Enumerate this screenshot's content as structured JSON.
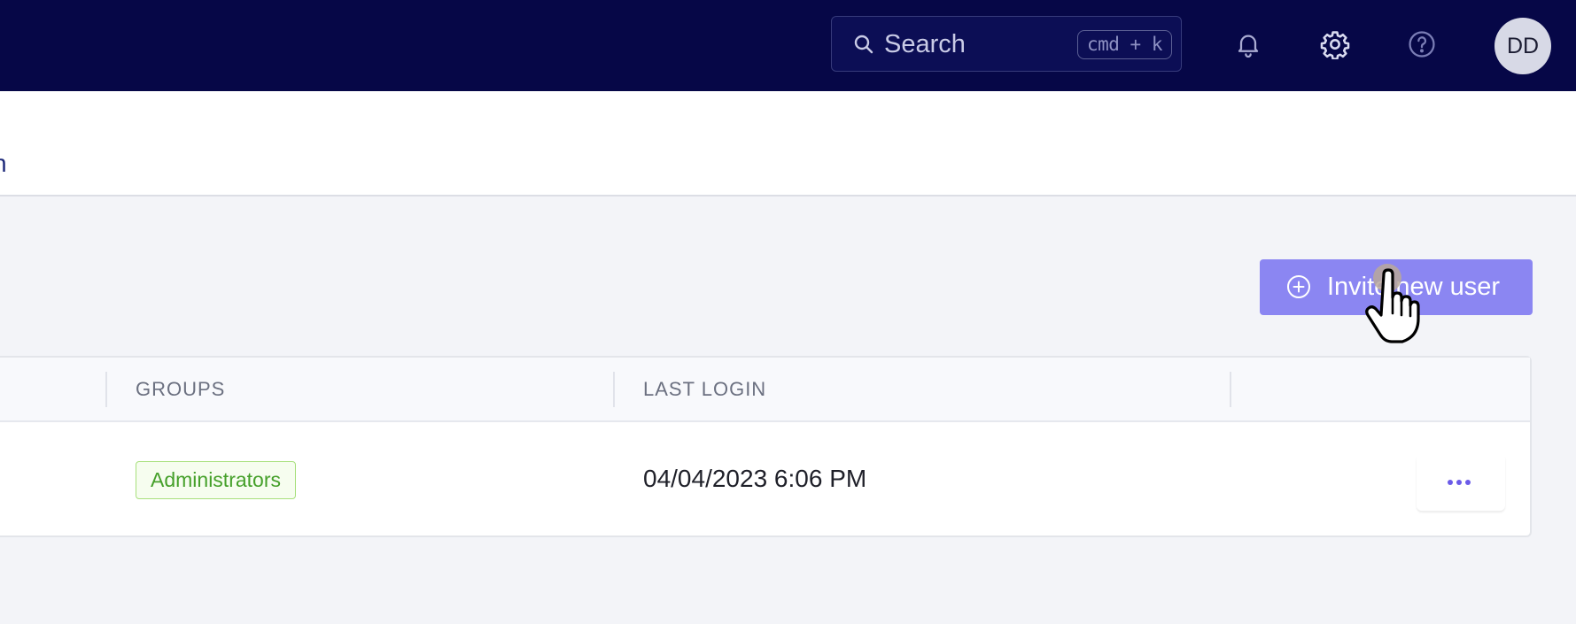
{
  "header": {
    "search": {
      "placeholder": "Search",
      "shortcut": "cmd + k"
    },
    "icons": [
      "bell-icon",
      "gear-icon",
      "help-circle-icon"
    ],
    "avatar_initials": "DD"
  },
  "subheader": {
    "tab_fragment": "n"
  },
  "actions": {
    "invite_label": "Invite new user"
  },
  "table": {
    "columns": [
      "GROUPS",
      "LAST LOGIN"
    ],
    "rows": [
      {
        "group": "Administrators",
        "last_login": "04/04/2023 6:06 PM"
      }
    ]
  },
  "colors": {
    "header_bg": "#060747",
    "accent": "#8b86f2",
    "badge_green": "#45a02a"
  }
}
